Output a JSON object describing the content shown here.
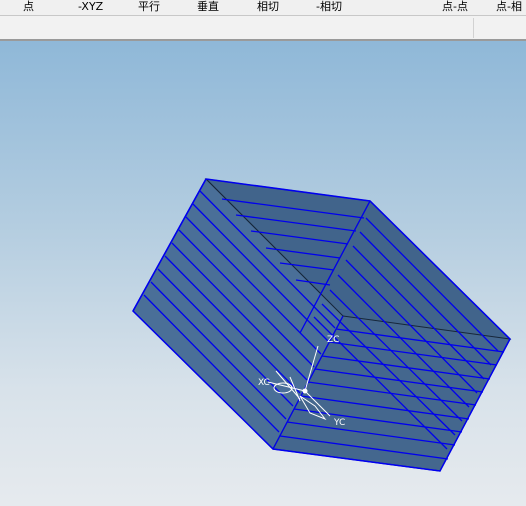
{
  "menubar": {
    "items": [
      {
        "label": "点"
      },
      {
        "label": "-XYZ"
      },
      {
        "label": "平行"
      },
      {
        "label": "垂直"
      },
      {
        "label": "相切"
      },
      {
        "label": "-相切"
      },
      {
        "label": "点-点"
      },
      {
        "label": "点-相"
      }
    ]
  },
  "viewport": {
    "axes": {
      "zc": "ZC",
      "xc": "XC",
      "yc": "YC"
    },
    "colors": {
      "body_face": "#4a6f98",
      "edge_lines": "#0000ee"
    }
  }
}
